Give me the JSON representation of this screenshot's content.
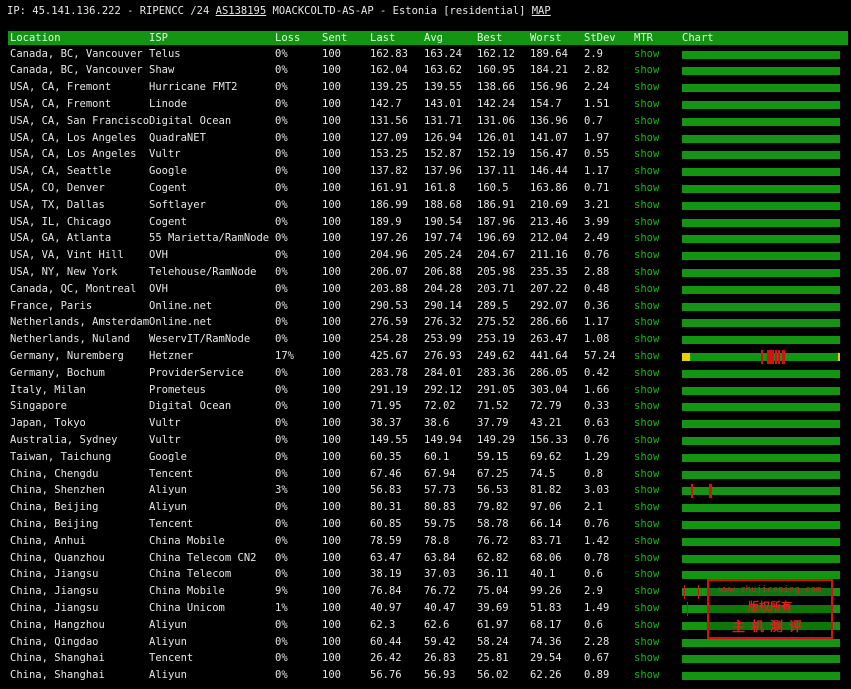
{
  "header_line": {
    "ip_text": "IP: 45.141.136.222 - RIPENCC /24",
    "asn": "AS138195",
    "org_text": "MOACKCOLTD-AS-AP - Estonia [residential]",
    "map": "MAP"
  },
  "columns": {
    "location": "Location",
    "isp": "ISP",
    "loss": "Loss",
    "sent": "Sent",
    "last": "Last",
    "avg": "Avg",
    "best": "Best",
    "worst": "Worst",
    "stdev": "StDev",
    "mtr": "MTR",
    "chart": "Chart"
  },
  "colors": {
    "header_bg": "#139413",
    "chart_bar": "#139413",
    "mtr_link": "#17b817",
    "loss_mark": "#d81010",
    "warn_mark": "#e8d000"
  },
  "rows": [
    {
      "location": "Canada, BC, Vancouver",
      "isp": "Telus",
      "loss": "0%",
      "sent": "100",
      "last": "162.83",
      "avg": "163.24",
      "best": "162.12",
      "worst": "189.64",
      "stdev": "2.9",
      "mtr": "show",
      "marks": []
    },
    {
      "location": "Canada, BC, Vancouver",
      "isp": "Shaw",
      "loss": "0%",
      "sent": "100",
      "last": "162.04",
      "avg": "163.62",
      "best": "160.95",
      "worst": "184.21",
      "stdev": "2.82",
      "mtr": "show",
      "marks": []
    },
    {
      "location": "USA, CA, Fremont",
      "isp": "Hurricane FMT2",
      "loss": "0%",
      "sent": "100",
      "last": "139.25",
      "avg": "139.55",
      "best": "138.66",
      "worst": "156.96",
      "stdev": "2.24",
      "mtr": "show",
      "marks": []
    },
    {
      "location": "USA, CA, Fremont",
      "isp": "Linode",
      "loss": "0%",
      "sent": "100",
      "last": "142.7",
      "avg": "143.01",
      "best": "142.24",
      "worst": "154.7",
      "stdev": "1.51",
      "mtr": "show",
      "marks": []
    },
    {
      "location": "USA, CA, San Francisco",
      "isp": "Digital Ocean",
      "loss": "0%",
      "sent": "100",
      "last": "131.56",
      "avg": "131.71",
      "best": "131.06",
      "worst": "136.96",
      "stdev": "0.7",
      "mtr": "show",
      "marks": []
    },
    {
      "location": "USA, CA, Los Angeles",
      "isp": "QuadraNET",
      "loss": "0%",
      "sent": "100",
      "last": "127.09",
      "avg": "126.94",
      "best": "126.01",
      "worst": "141.07",
      "stdev": "1.97",
      "mtr": "show",
      "marks": []
    },
    {
      "location": "USA, CA, Los Angeles",
      "isp": "Vultr",
      "loss": "0%",
      "sent": "100",
      "last": "153.25",
      "avg": "152.87",
      "best": "152.19",
      "worst": "156.47",
      "stdev": "0.55",
      "mtr": "show",
      "marks": []
    },
    {
      "location": "USA, CA, Seattle",
      "isp": "Google",
      "loss": "0%",
      "sent": "100",
      "last": "137.82",
      "avg": "137.96",
      "best": "137.11",
      "worst": "146.44",
      "stdev": "1.17",
      "mtr": "show",
      "marks": []
    },
    {
      "location": "USA, CO, Denver",
      "isp": "Cogent",
      "loss": "0%",
      "sent": "100",
      "last": "161.91",
      "avg": "161.8",
      "best": "160.5",
      "worst": "163.86",
      "stdev": "0.71",
      "mtr": "show",
      "marks": []
    },
    {
      "location": "USA, TX, Dallas",
      "isp": "Softlayer",
      "loss": "0%",
      "sent": "100",
      "last": "186.99",
      "avg": "188.68",
      "best": "186.91",
      "worst": "210.69",
      "stdev": "3.21",
      "mtr": "show",
      "marks": []
    },
    {
      "location": "USA, IL, Chicago",
      "isp": "Cogent",
      "loss": "0%",
      "sent": "100",
      "last": "189.9",
      "avg": "190.54",
      "best": "187.96",
      "worst": "213.46",
      "stdev": "3.99",
      "mtr": "show",
      "marks": []
    },
    {
      "location": "USA, GA, Atlanta",
      "isp": "55 Marietta/RamNode",
      "loss": "0%",
      "sent": "100",
      "last": "197.26",
      "avg": "197.74",
      "best": "196.69",
      "worst": "212.04",
      "stdev": "2.49",
      "mtr": "show",
      "marks": []
    },
    {
      "location": "USA, VA, Vint Hill",
      "isp": "OVH",
      "loss": "0%",
      "sent": "100",
      "last": "204.96",
      "avg": "205.24",
      "best": "204.67",
      "worst": "211.16",
      "stdev": "0.76",
      "mtr": "show",
      "marks": []
    },
    {
      "location": "USA, NY, New York",
      "isp": "Telehouse/RamNode",
      "loss": "0%",
      "sent": "100",
      "last": "206.07",
      "avg": "206.88",
      "best": "205.98",
      "worst": "235.35",
      "stdev": "2.88",
      "mtr": "show",
      "marks": []
    },
    {
      "location": "Canada, QC, Montreal",
      "isp": "OVH",
      "loss": "0%",
      "sent": "100",
      "last": "203.88",
      "avg": "204.28",
      "best": "203.71",
      "worst": "207.22",
      "stdev": "0.48",
      "mtr": "show",
      "marks": []
    },
    {
      "location": "France, Paris",
      "isp": "Online.net",
      "loss": "0%",
      "sent": "100",
      "last": "290.53",
      "avg": "290.14",
      "best": "289.5",
      "worst": "292.07",
      "stdev": "0.36",
      "mtr": "show",
      "marks": []
    },
    {
      "location": "Netherlands, Amsterdam",
      "isp": "Online.net",
      "loss": "0%",
      "sent": "100",
      "last": "276.59",
      "avg": "276.32",
      "best": "275.52",
      "worst": "286.66",
      "stdev": "1.17",
      "mtr": "show",
      "marks": []
    },
    {
      "location": "Netherlands, Nuland",
      "isp": "WeservIT/RamNode",
      "loss": "0%",
      "sent": "100",
      "last": "254.28",
      "avg": "253.99",
      "best": "253.19",
      "worst": "263.47",
      "stdev": "1.08",
      "mtr": "show",
      "marks": []
    },
    {
      "location": "Germany, Nuremberg",
      "isp": "Hetzner",
      "loss": "17%",
      "sent": "100",
      "last": "425.67",
      "avg": "276.93",
      "best": "249.62",
      "worst": "441.64",
      "stdev": "57.24",
      "mtr": "show",
      "marks": [
        0,
        1,
        2,
        3,
        4,
        50,
        54,
        55,
        56,
        57,
        59,
        61,
        63,
        64,
        99
      ]
    },
    {
      "location": "Germany, Bochum",
      "isp": "ProviderService",
      "loss": "0%",
      "sent": "100",
      "last": "283.78",
      "avg": "284.01",
      "best": "283.36",
      "worst": "286.05",
      "stdev": "0.42",
      "mtr": "show",
      "marks": []
    },
    {
      "location": "Italy, Milan",
      "isp": "Prometeus",
      "loss": "0%",
      "sent": "100",
      "last": "291.19",
      "avg": "292.12",
      "best": "291.05",
      "worst": "303.04",
      "stdev": "1.66",
      "mtr": "show",
      "marks": []
    },
    {
      "location": "Singapore",
      "isp": "Digital Ocean",
      "loss": "0%",
      "sent": "100",
      "last": "71.95",
      "avg": "72.02",
      "best": "71.52",
      "worst": "72.79",
      "stdev": "0.33",
      "mtr": "show",
      "marks": []
    },
    {
      "location": "Japan, Tokyo",
      "isp": "Vultr",
      "loss": "0%",
      "sent": "100",
      "last": "38.37",
      "avg": "38.6",
      "best": "37.79",
      "worst": "43.21",
      "stdev": "0.63",
      "mtr": "show",
      "marks": []
    },
    {
      "location": "Australia, Sydney",
      "isp": "Vultr",
      "loss": "0%",
      "sent": "100",
      "last": "149.55",
      "avg": "149.94",
      "best": "149.29",
      "worst": "156.33",
      "stdev": "0.76",
      "mtr": "show",
      "marks": []
    },
    {
      "location": "Taiwan, Taichung",
      "isp": "Google",
      "loss": "0%",
      "sent": "100",
      "last": "60.35",
      "avg": "60.1",
      "best": "59.15",
      "worst": "69.62",
      "stdev": "1.29",
      "mtr": "show",
      "marks": []
    },
    {
      "location": "China, Chengdu",
      "isp": "Tencent",
      "loss": "0%",
      "sent": "100",
      "last": "67.46",
      "avg": "67.94",
      "best": "67.25",
      "worst": "74.5",
      "stdev": "0.8",
      "mtr": "show",
      "marks": []
    },
    {
      "location": "China, Shenzhen",
      "isp": "Aliyun",
      "loss": "3%",
      "sent": "100",
      "last": "56.83",
      "avg": "57.73",
      "best": "56.53",
      "worst": "81.82",
      "stdev": "3.03",
      "mtr": "show",
      "marks": [
        6,
        17,
        18
      ]
    },
    {
      "location": "China, Beijing",
      "isp": "Aliyun",
      "loss": "0%",
      "sent": "100",
      "last": "80.31",
      "avg": "80.83",
      "best": "79.82",
      "worst": "97.06",
      "stdev": "2.1",
      "mtr": "show",
      "marks": []
    },
    {
      "location": "China, Beijing",
      "isp": "Tencent",
      "loss": "0%",
      "sent": "100",
      "last": "60.85",
      "avg": "59.75",
      "best": "58.78",
      "worst": "66.14",
      "stdev": "0.76",
      "mtr": "show",
      "marks": []
    },
    {
      "location": "China, Anhui",
      "isp": "China Mobile",
      "loss": "0%",
      "sent": "100",
      "last": "78.59",
      "avg": "78.8",
      "best": "76.72",
      "worst": "83.71",
      "stdev": "1.42",
      "mtr": "show",
      "marks": []
    },
    {
      "location": "China, Quanzhou",
      "isp": "China Telecom CN2",
      "loss": "0%",
      "sent": "100",
      "last": "63.47",
      "avg": "63.84",
      "best": "62.82",
      "worst": "68.06",
      "stdev": "0.78",
      "mtr": "show",
      "marks": []
    },
    {
      "location": "China, Jiangsu",
      "isp": "China Telecom",
      "loss": "0%",
      "sent": "100",
      "last": "38.19",
      "avg": "37.03",
      "best": "36.11",
      "worst": "40.1",
      "stdev": "0.6",
      "mtr": "show",
      "marks": []
    },
    {
      "location": "China, Jiangsu",
      "isp": "China Mobile",
      "loss": "9%",
      "sent": "100",
      "last": "76.84",
      "avg": "76.72",
      "best": "75.04",
      "worst": "99.26",
      "stdev": "2.9",
      "mtr": "show",
      "marks": [
        1,
        10
      ]
    },
    {
      "location": "China, Jiangsu",
      "isp": "China Unicom",
      "loss": "1%",
      "sent": "100",
      "last": "40.97",
      "avg": "40.47",
      "best": "39.69",
      "worst": "51.83",
      "stdev": "1.49",
      "mtr": "show",
      "marks": [
        3
      ]
    },
    {
      "location": "China, Hangzhou",
      "isp": "Aliyun",
      "loss": "0%",
      "sent": "100",
      "last": "62.3",
      "avg": "62.6",
      "best": "61.97",
      "worst": "68.17",
      "stdev": "0.6",
      "mtr": "show",
      "marks": []
    },
    {
      "location": "China, Qingdao",
      "isp": "Aliyun",
      "loss": "0%",
      "sent": "100",
      "last": "60.44",
      "avg": "59.42",
      "best": "58.24",
      "worst": "74.36",
      "stdev": "2.28",
      "mtr": "show",
      "marks": []
    },
    {
      "location": "China, Shanghai",
      "isp": "Tencent",
      "loss": "0%",
      "sent": "100",
      "last": "26.42",
      "avg": "26.83",
      "best": "25.81",
      "worst": "29.54",
      "stdev": "0.67",
      "mtr": "show",
      "marks": []
    },
    {
      "location": "China, Shanghai",
      "isp": "Aliyun",
      "loss": "0%",
      "sent": "100",
      "last": "56.76",
      "avg": "56.93",
      "best": "56.02",
      "worst": "62.26",
      "stdev": "0.89",
      "mtr": "show",
      "marks": []
    }
  ],
  "watermark": {
    "line1": "www.zhujiceping.com",
    "line2": "版权所有",
    "line3": "主机测评"
  }
}
